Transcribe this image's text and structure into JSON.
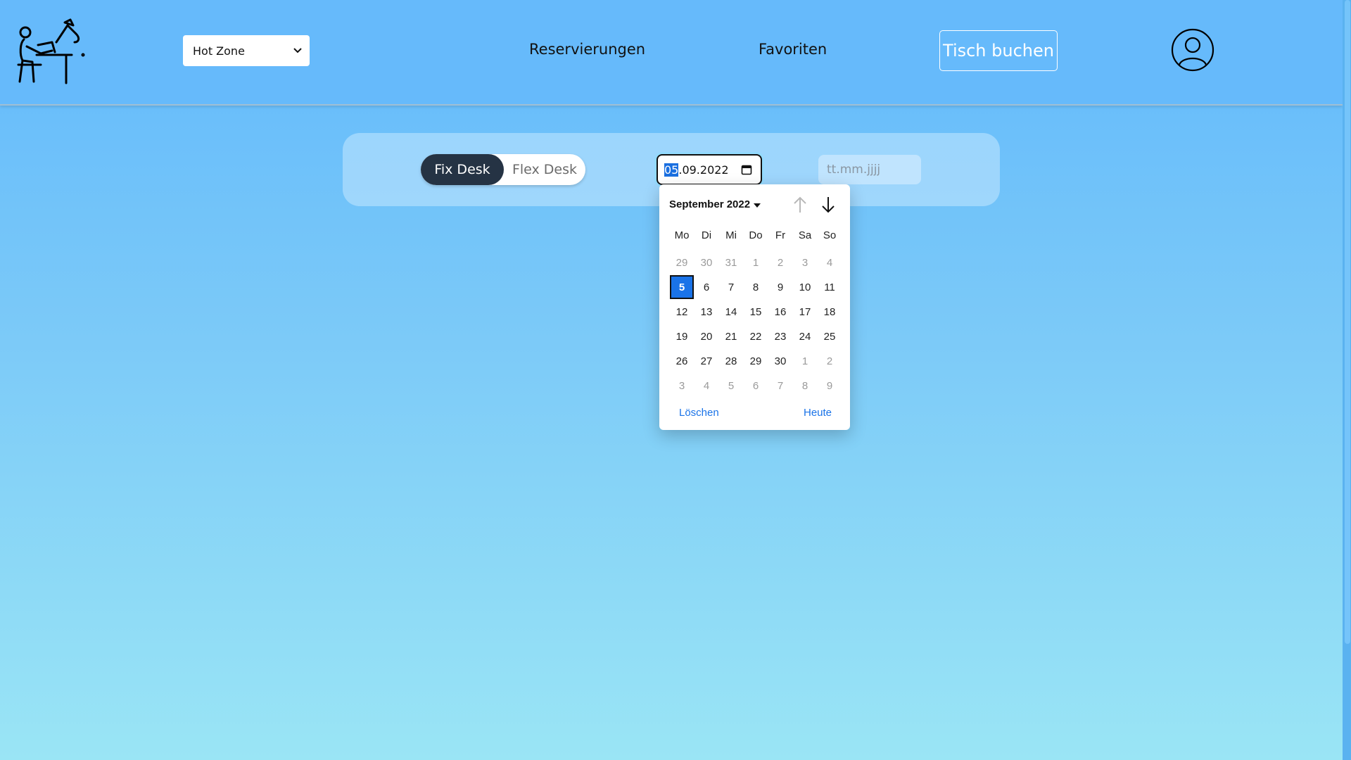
{
  "header": {
    "zone_select": "Hot Zone",
    "nav_reservations": "Reservierungen",
    "nav_favorites": "Favoriten",
    "nav_book": "Tisch buchen"
  },
  "filter": {
    "fix_desk": "Fix Desk",
    "flex_desk": "Flex Desk",
    "date_day": "05",
    "date_rest": ".09.2022",
    "end_placeholder": "tt.mm.jjjj"
  },
  "datepicker": {
    "month_label": "September 2022",
    "weekdays": [
      "Mo",
      "Di",
      "Mi",
      "Do",
      "Fr",
      "Sa",
      "So"
    ],
    "weeks": [
      [
        "29",
        "30",
        "31",
        "1",
        "2",
        "3",
        "4"
      ],
      [
        "5",
        "6",
        "7",
        "8",
        "9",
        "10",
        "11"
      ],
      [
        "12",
        "13",
        "14",
        "15",
        "16",
        "17",
        "18"
      ],
      [
        "19",
        "20",
        "21",
        "22",
        "23",
        "24",
        "25"
      ],
      [
        "26",
        "27",
        "28",
        "29",
        "30",
        "1",
        "2"
      ],
      [
        "3",
        "4",
        "5",
        "6",
        "7",
        "8",
        "9"
      ]
    ],
    "selected_day": "5",
    "clear_label": "Löschen",
    "today_label": "Heute"
  },
  "colors": {
    "accent": "#1a73e8",
    "toggle_active": "#253344",
    "header_bg": "#66bafb"
  }
}
